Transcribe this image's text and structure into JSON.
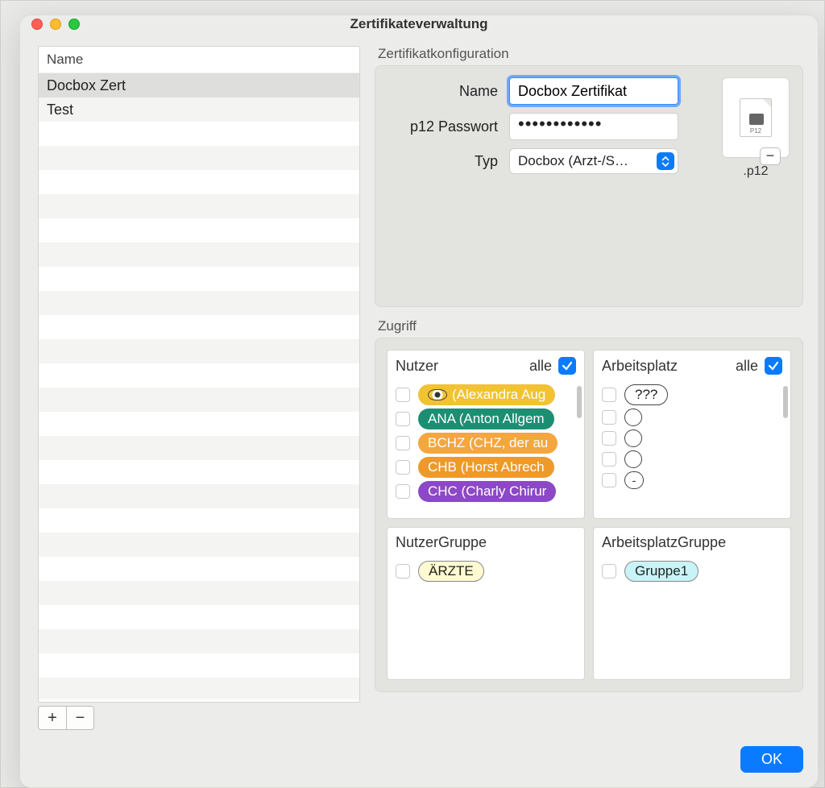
{
  "window": {
    "title": "Zertifikateverwaltung"
  },
  "source_list": {
    "header": "Name",
    "items": [
      "Docbox Zert",
      "Test"
    ],
    "selected_index": 0
  },
  "config": {
    "section_title": "Zertifikatkonfiguration",
    "name_label": "Name",
    "name_value": "Docbox Zertifikat",
    "pw_label": "p12 Passwort",
    "pw_value": "••••••••••••",
    "typ_label": "Typ",
    "typ_value": "Docbox (Arzt-/S…",
    "file_ext": ".p12",
    "file_tiny": "P12"
  },
  "access": {
    "section_title": "Zugriff",
    "nutzer": {
      "header": "Nutzer",
      "alle_label": "alle",
      "alle_checked": true,
      "items": [
        {
          "label": " (Alexandra Aug",
          "color": "#f1c232",
          "eye": true
        },
        {
          "label": "ANA (Anton Allgem",
          "color": "#1c8f73"
        },
        {
          "label": "BCHZ (CHZ, der au",
          "color": "#f4a63f"
        },
        {
          "label": "CHB (Horst Abrech",
          "color": "#ed9a2a"
        },
        {
          "label": "CHC (Charly Chirur",
          "color": "#8c48c7"
        }
      ]
    },
    "arbeitsplatz": {
      "header": "Arbeitsplatz",
      "alle_label": "alle",
      "alle_checked": true,
      "items": [
        {
          "label": "???",
          "outline": true
        },
        {
          "empty_circle": true
        },
        {
          "empty_circle": true
        },
        {
          "empty_circle": true
        },
        {
          "char": "-"
        }
      ]
    },
    "nutzer_gruppe": {
      "header": "NutzerGruppe",
      "items": [
        {
          "label": "ÄRZTE",
          "color": "#fffad1",
          "text_dark": true
        }
      ]
    },
    "arbeitsplatz_gruppe": {
      "header": "ArbeitsplatzGruppe",
      "items": [
        {
          "label": "Gruppe1",
          "color": "#c9f4f7",
          "text_dark": true
        }
      ]
    }
  },
  "footer": {
    "ok": "OK"
  }
}
